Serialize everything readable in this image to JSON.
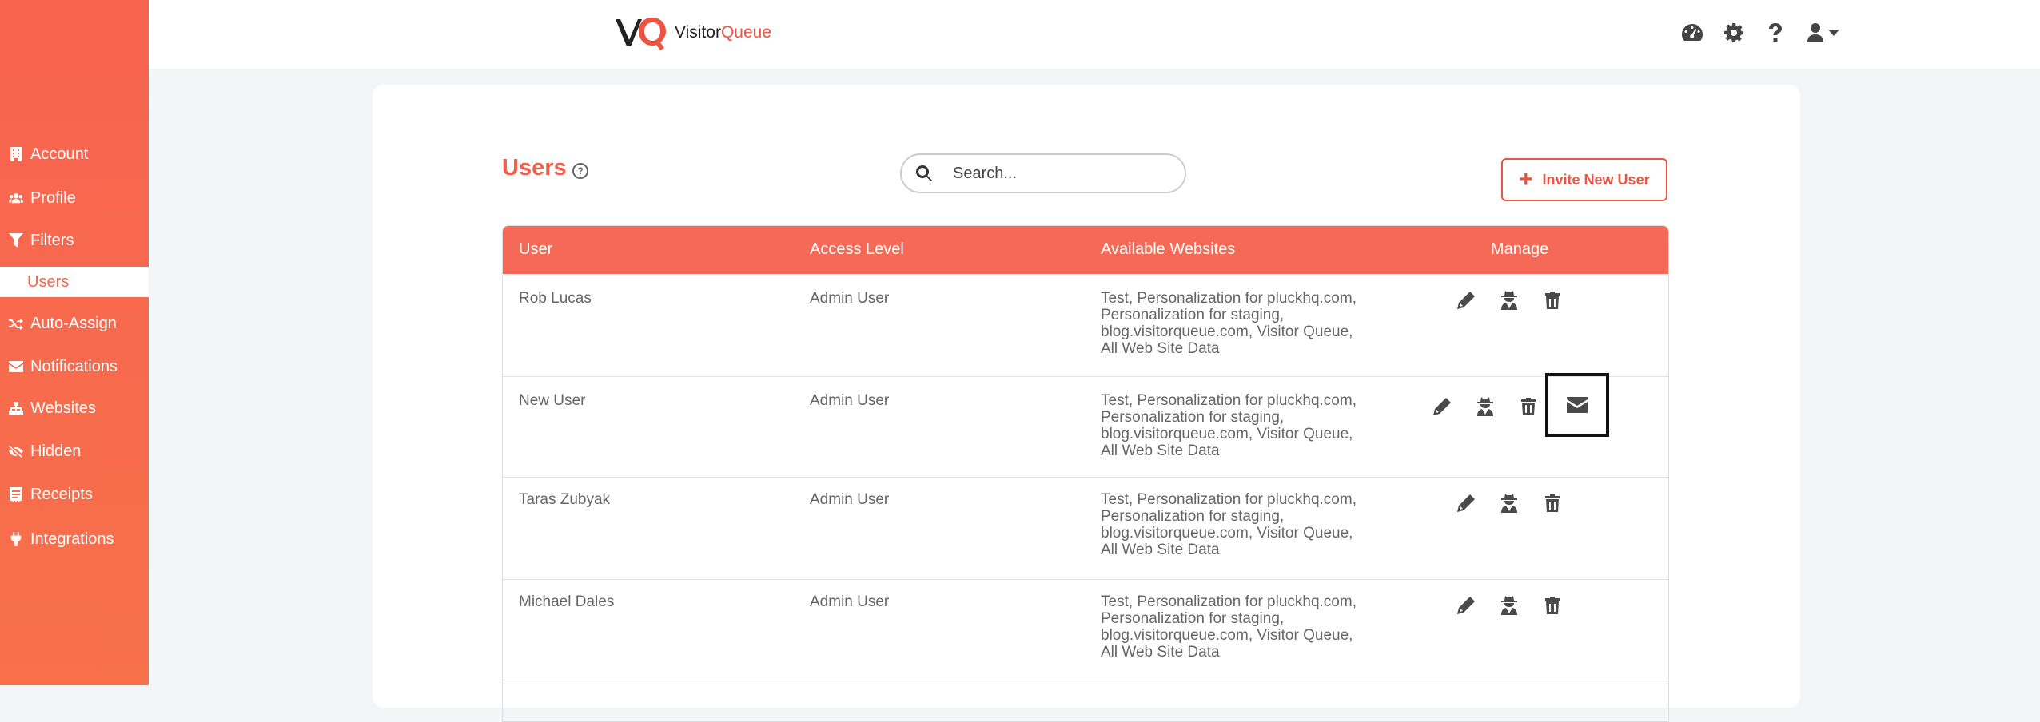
{
  "sidebar": {
    "items": [
      {
        "label": "Account",
        "icon": "building-icon"
      },
      {
        "label": "Profile",
        "icon": "users-icon"
      },
      {
        "label": "Filters",
        "icon": "filter-icon"
      },
      {
        "label": "Users",
        "icon": ""
      },
      {
        "label": "Auto-Assign",
        "icon": "shuffle-icon"
      },
      {
        "label": "Notifications",
        "icon": "envelope-icon"
      },
      {
        "label": "Websites",
        "icon": "sitemap-icon"
      },
      {
        "label": "Hidden",
        "icon": "eye-slash-icon"
      },
      {
        "label": "Receipts",
        "icon": "receipt-icon"
      },
      {
        "label": "Integrations",
        "icon": "plug-icon"
      }
    ]
  },
  "header": {
    "logo_mark": "VQ",
    "logo_word_a": "Visitor",
    "logo_word_b": "Queue"
  },
  "main": {
    "title": "Users",
    "help_symbol": "?",
    "search_placeholder": "Search...",
    "invite_label": "Invite New User",
    "invite_symbol": "+"
  },
  "table": {
    "columns": [
      "User",
      "Access Level",
      "Available Websites",
      "Manage"
    ],
    "rows": [
      {
        "user": "Rob Lucas",
        "access": "Admin User",
        "websites": "Test, Personalization for pluckhq.com, Personalization for staging, blog.visitorqueue.com, Visitor Queue, All Web Site Data"
      },
      {
        "user": "New User",
        "access": "Admin User",
        "websites": "Test, Personalization for pluckhq.com, Personalization for staging, blog.visitorqueue.com, Visitor Queue, All Web Site Data"
      },
      {
        "user": "Taras Zubyak",
        "access": "Admin User",
        "websites": "Test, Personalization for pluckhq.com, Personalization for staging, blog.visitorqueue.com, Visitor Queue, All Web Site Data"
      },
      {
        "user": "Michael Dales",
        "access": "Admin User",
        "websites": "Test, Personalization for pluckhq.com, Personalization for staging, blog.visitorqueue.com, Visitor Queue, All Web Site Data"
      }
    ]
  },
  "colors": {
    "brand": "#f86350",
    "header_row": "#f56a57",
    "icon": "#4a4a4a"
  }
}
